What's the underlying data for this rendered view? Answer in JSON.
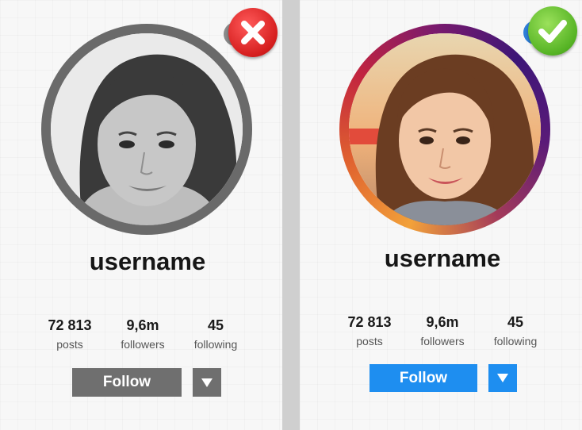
{
  "profiles": [
    {
      "username": "username",
      "stats": [
        {
          "value": "72 813",
          "label": "posts"
        },
        {
          "value": "9,6m",
          "label": "followers"
        },
        {
          "value": "45",
          "label": "following"
        }
      ],
      "follow_label": "Follow",
      "verdict_icon": "x-mark-icon",
      "accent": "#6f6f6f",
      "photo_style": "grayscale"
    },
    {
      "username": "username",
      "stats": [
        {
          "value": "72 813",
          "label": "posts"
        },
        {
          "value": "9,6m",
          "label": "followers"
        },
        {
          "value": "45",
          "label": "following"
        }
      ],
      "follow_label": "Follow",
      "verdict_icon": "check-mark-icon",
      "accent": "#1e8ef0",
      "photo_style": "color"
    }
  ]
}
